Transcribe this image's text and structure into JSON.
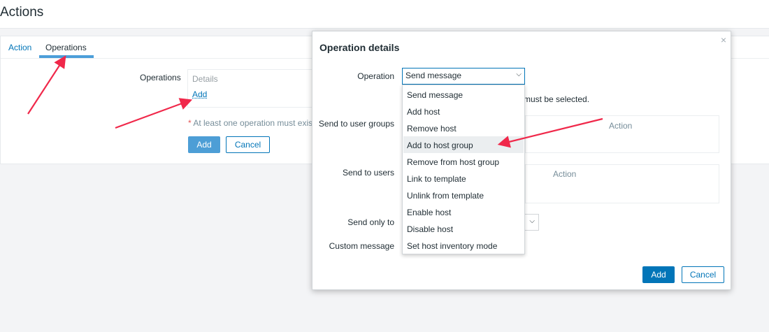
{
  "page": {
    "title": "Actions"
  },
  "tabs": [
    {
      "label": "Action"
    },
    {
      "label": "Operations"
    }
  ],
  "form": {
    "operations_label": "Operations",
    "details_header": "Details",
    "add_link": "Add",
    "required_note": "At least one operation must exist.",
    "add_button": "Add",
    "cancel_button": "Cancel"
  },
  "modal": {
    "title": "Operation details",
    "close_icon": "×",
    "operation_label": "Operation",
    "operation_value": "Send message",
    "must_note": "must be selected.",
    "groups_label": "Send to user groups",
    "groups_action_header": "Action",
    "users_label": "Send to users",
    "users_action_header": "Action",
    "send_only_label": "Send only to",
    "custom_message_label": "Custom message",
    "add_button": "Add",
    "cancel_button": "Cancel",
    "dropdown_options": [
      "Send message",
      "Add host",
      "Remove host",
      "Add to host group",
      "Remove from host group",
      "Link to template",
      "Unlink from template",
      "Enable host",
      "Disable host",
      "Set host inventory mode"
    ],
    "highlighted_option": "Add to host group"
  },
  "colors": {
    "accent": "#0275b8",
    "annotation_arrow": "#f0284a",
    "tab_underline": "#4c9ed9"
  },
  "icons": {
    "chevron": "chevron-down-icon",
    "close": "close-icon"
  }
}
